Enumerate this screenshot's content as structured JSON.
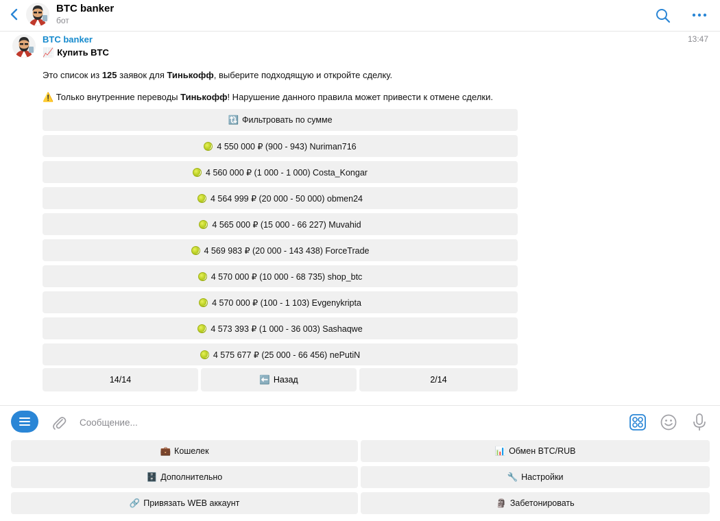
{
  "header": {
    "title": "BTC banker",
    "subtitle": "бот"
  },
  "message": {
    "sender": "BTC banker",
    "time": "13:47",
    "heading_emoji": "📈",
    "heading": "Купить BTC",
    "line1_a": "Это список из ",
    "line1_count": "125",
    "line1_b": " заявок для ",
    "line1_bank": "Тинькофф",
    "line1_c": ", выберите подходящую и откройте сделку.",
    "line2_icon": "⚠️",
    "line2_a": " Только внутренние переводы ",
    "line2_bank": "Тинькофф",
    "line2_b": "! Нарушение данного правила может привести к отмене сделки."
  },
  "inline_keyboard": {
    "filter_icon": "🔃",
    "filter_label": "Фильтровать по сумме",
    "offers": [
      {
        "label": "4 550 000 ₽ (900 - 943) Nuriman716"
      },
      {
        "label": "4 560 000 ₽ (1 000 - 1 000) Costa_Kongar"
      },
      {
        "label": "4 564 999 ₽ (20 000 - 50 000) obmen24"
      },
      {
        "label": "4 565 000 ₽ (15 000 - 66 227) Muvahid"
      },
      {
        "label": "4 569 983 ₽ (20 000 - 143 438) ForceTrade"
      },
      {
        "label": "4 570 000 ₽ (10 000 - 68 735) shop_btc"
      },
      {
        "label": "4 570 000 ₽ (100 - 1 103) Evgenykripta"
      },
      {
        "label": "4 573 393 ₽ (1 000 - 36 003) Sashaqwe"
      },
      {
        "label": "4 575 677 ₽ (25 000 - 66 456) nePutiN"
      }
    ],
    "nav_prev": "14/14",
    "nav_back_icon": "⬅️",
    "nav_back": "Назад",
    "nav_next": "2/14"
  },
  "composer": {
    "placeholder": "Сообщение..."
  },
  "reply_keyboard": {
    "wallet_icon": "💼",
    "wallet": "Кошелек",
    "exchange_icon": "📊",
    "exchange": "Обмен BTC/RUB",
    "more_icon": "🗄️",
    "more": "Дополнительно",
    "settings_icon": "🔧",
    "settings": "Настройки",
    "web_icon": "🔗",
    "web": "Привязать WEB аккаунт",
    "concrete_icon": "🗿",
    "concrete": "Забетонировать"
  },
  "colors": {
    "accent": "#168acd",
    "menu_button": "#2a86d6",
    "button_bg": "#f0f0f0"
  }
}
